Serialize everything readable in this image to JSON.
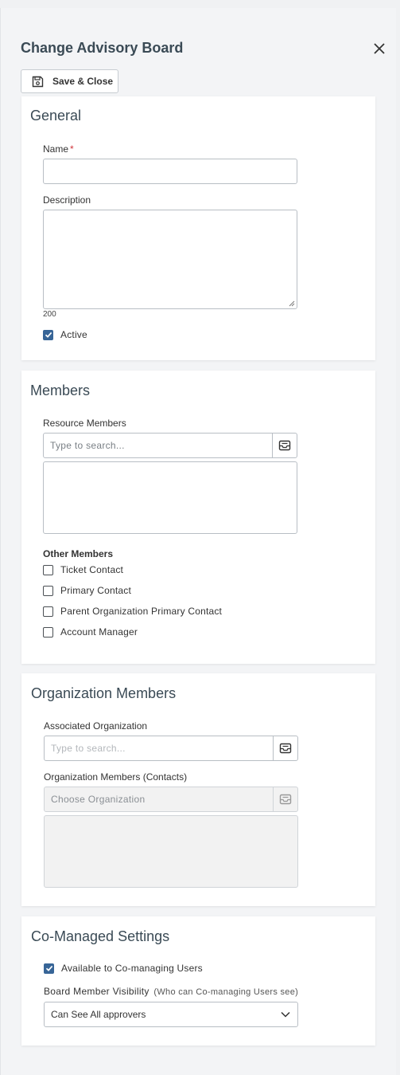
{
  "header": {
    "title": "Change Advisory Board",
    "save_close_label": "Save & Close",
    "close_icon": "close-icon",
    "save_icon": "save-icon"
  },
  "general": {
    "heading": "General",
    "name_label": "Name",
    "name_required_marker": "*",
    "name_value": "",
    "description_label": "Description",
    "description_value": "",
    "char_counter": "200",
    "active_label": "Active",
    "active_checked": true
  },
  "members": {
    "heading": "Members",
    "resource_members_label": "Resource Members",
    "resource_search_placeholder": "Type to search...",
    "other_members_label": "Other Members",
    "other_members": [
      {
        "label": "Ticket Contact",
        "checked": false
      },
      {
        "label": "Primary Contact",
        "checked": false
      },
      {
        "label": "Parent Organization Primary Contact",
        "checked": false
      },
      {
        "label": "Account Manager",
        "checked": false
      }
    ]
  },
  "organization_members": {
    "heading": "Organization Members",
    "associated_org_label": "Associated Organization",
    "associated_org_placeholder": "Type to search...",
    "contacts_label": "Organization Members (Contacts)",
    "contacts_placeholder": "Choose Organization"
  },
  "co_managed": {
    "heading": "Co-Managed Settings",
    "available_label": "Available to Co-managing Users",
    "available_checked": true,
    "visibility_label": "Board Member Visibility",
    "visibility_hint": "(Who can Co-managing Users see)",
    "visibility_value": "Can See All approvers"
  },
  "colors": {
    "accent": "#376597",
    "required": "#d0343a",
    "title": "#3a4a55"
  }
}
